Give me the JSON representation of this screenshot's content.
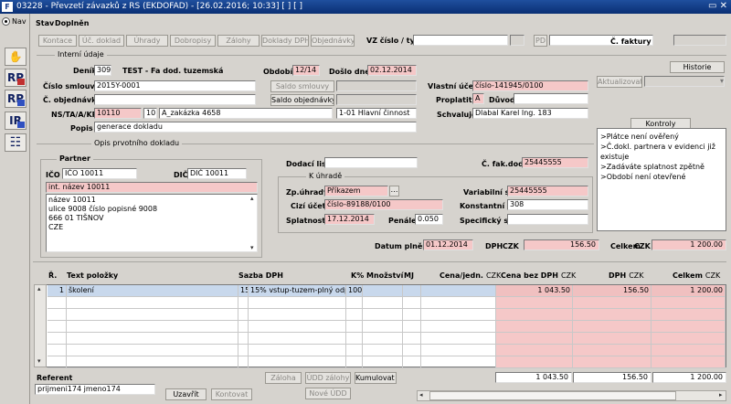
{
  "window": {
    "title": "03228 - Převzetí závazků z RS (EKDOFAD) - [26.02.2016; 10:33] [ ] [ ]",
    "controls": "▭ ✕"
  },
  "leftbar": {
    "nav_label": "Nav",
    "icons": [
      {
        "name": "handshake-icon",
        "glyph": "✋"
      },
      {
        "name": "rp-check-icon",
        "glyph": "RP"
      },
      {
        "name": "rp-grid-icon",
        "glyph": "RP"
      },
      {
        "name": "ir-icon",
        "glyph": "IR"
      },
      {
        "name": "checklist-icon",
        "glyph": "☷"
      }
    ]
  },
  "header": {
    "stav_label": "Stav",
    "stav_value": "Doplněn",
    "tabs": [
      "Kontace",
      "Úč. doklad",
      "Úhrady",
      "Dobropisy",
      "Zálohy",
      "Doklady DPH",
      "Objednávky"
    ],
    "vz_label": "VZ číslo / typ",
    "vz_value": "",
    "vz_type": "",
    "pd_label": "PD",
    "pd_value": "",
    "faktury_label": "Č. faktury",
    "faktury_value": ""
  },
  "interni": {
    "section": "Interní údaje",
    "historie": "Historie",
    "denik_label": "Deník",
    "denik_code": "309",
    "denik_name": "TEST - Fa dod. tuzemská",
    "obdobi_label": "Období",
    "obdobi_value": "12/14",
    "doslo_label": "Došlo dne",
    "doslo_value": "02.12.2014",
    "smlouvy_label": "Číslo smlouvy",
    "smlouvy_value": "2015Y-0001",
    "saldo_smlouvy": "Saldo smlouvy",
    "objednavky_label": "Č. objednávky",
    "objednavky_value": "",
    "saldo_objednavky": "Saldo objednávky",
    "vlastni_label": "Vlastní účet",
    "vlastni_value": "číslo-141945/0100",
    "aktualizovat": "Aktualizovat",
    "proplatit_label": "Proplatit",
    "proplatit_value": "A",
    "duvod_label": "Důvod",
    "duvod_value": "",
    "ns_label": "NS/TA/A/KP",
    "ns_value": "10110",
    "ta_value": "10",
    "akce_value": "A_zakázka 4658",
    "kp_value": "1-01 Hlavní činnost",
    "schvaluje_label": "Schvaluje",
    "schvaluje_value": "Dlabal Karel Ing. 183",
    "popis_label": "Popis",
    "popis_value": "generace dokladu"
  },
  "kontroly": {
    "button": "Kontroly",
    "items": [
      ">Plátce není ověřený",
      ">Č.dokl. partnera v evidenci již existuje",
      ">Zadáváte splatnost zpětně",
      ">Období není otevřené"
    ]
  },
  "opis": {
    "section": "Opis prvotního dokladu",
    "partner_title": "Partner",
    "ico_label": "IČO",
    "ico_value": "IČO 10011",
    "dic_label": "DIČ",
    "dic_value": "DIČ 10011",
    "int_nazev": "int. název 10011",
    "address": [
      "název 10011",
      "ulice 9008 číslo popisné 9008",
      "666 01 TIŠNOV",
      "CZE"
    ],
    "dodaci_label": "Dodací list",
    "dodaci_value": "",
    "fakdod_label": "Č. fak.dod",
    "fakdod_value": "25445555",
    "k_uhrade_title": "K úhradě",
    "zpuhrady_label": "Zp.úhrady",
    "zpuhrady_value": "Příkazem",
    "variabilni_label": "Variabilní s.",
    "variabilni_value": "25445555",
    "cizi_label": "Cizí účet",
    "cizi_value": "číslo-89188/0100",
    "konstantni_label": "Konstantní s.",
    "konstantni_value": "308",
    "splatnost_label": "Splatnost",
    "splatnost_value": "17.12.2014",
    "penale_label": "Penále",
    "penale_value": "0.050",
    "specificky_label": "Specifický s.",
    "specificky_value": "",
    "plneni_label": "Datum plnění",
    "plneni_value": "01.12.2014",
    "dph_label": "DPH",
    "dph_unit": "CZK",
    "dph_value": "156.50",
    "celkem_label": "Celkem",
    "celkem_unit": "CZK",
    "celkem_value": "1 200.00"
  },
  "grid": {
    "headers": {
      "r": "Ř.",
      "text": "Text položky",
      "sazba": "Sazba DPH",
      "k": "K%",
      "mnozstvi": "Množství",
      "mj": "MJ",
      "cena": "Cena/jedn.",
      "bezdph": "Cena bez DPH",
      "dph": "DPH",
      "celkem": "Celkem",
      "unit": "CZK"
    },
    "row1": {
      "r": "1",
      "text": "školení",
      "sazba_code": "15",
      "sazba_name": "15% vstup-tuzem-plný odpoč",
      "k": "100",
      "mnozstvi": "",
      "mj": "",
      "cena": "",
      "bezdph": "1 043.50",
      "dph": "156.50",
      "celkem": "1 200.00"
    }
  },
  "footer": {
    "referent_label": "Referent",
    "referent_value": "prijmeni174 jmeno174",
    "uzavrit": "Uzavřít",
    "kontovat": "Kontovat",
    "zaloha": "Záloha",
    "udd_zalohy": "ÚDD zálohy",
    "kumulovat": "Kumulovat ř.",
    "nove_udd": "Nové ÚDD",
    "sum_bezdph": "1 043.50",
    "sum_dph": "156.50",
    "sum_celkem": "1 200.00"
  }
}
